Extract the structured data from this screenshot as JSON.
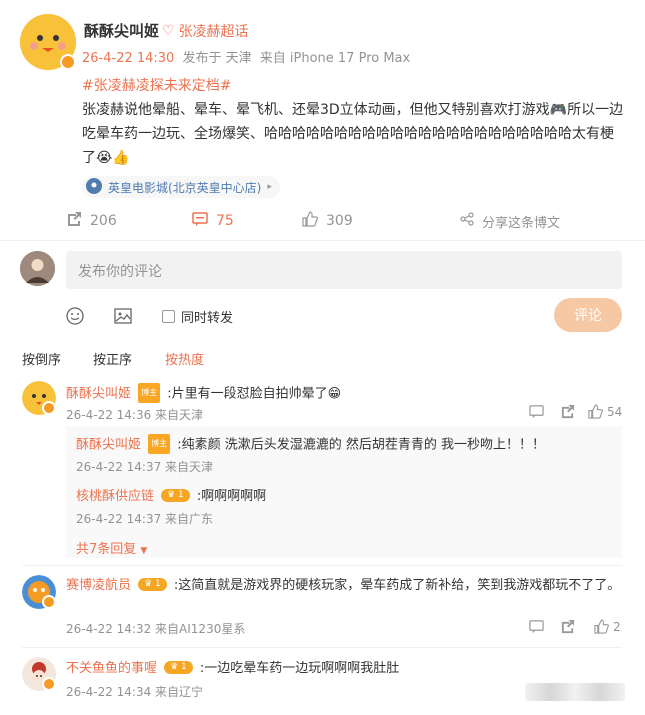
{
  "post": {
    "author": "酥酥尖叫姬",
    "topic_badge": "张凌赫超话",
    "time": "26-4-22 14:30",
    "from_location": "发布于 天津",
    "device": "来自 iPhone 17 Pro Max",
    "hashtag": "#张凌赫凌探未来定档#",
    "text": "张凌赫说他晕船、晕车、晕飞机、还晕3D立体动画，但他又特别喜欢打游戏🎮所以一边吃晕车药一边玩、全场爆笑、哈哈哈哈哈哈哈哈哈哈哈哈哈哈哈哈哈哈哈哈哈哈太有梗了😭👍",
    "location": "英皇电影城(北京英皇中心店)",
    "repost_count": "206",
    "comment_count": "75",
    "like_count": "309",
    "share_label": "分享这条博文"
  },
  "composer": {
    "placeholder": "发布你的评论",
    "repost_label": "同时转发",
    "submit_label": "评论"
  },
  "sort": {
    "oldest": "按倒序",
    "newest": "按正序",
    "hot": "按热度"
  },
  "comments": [
    {
      "name": "酥酥尖叫姬",
      "tag": "博主",
      "text": ":片里有一段怼脸自拍帅晕了😁",
      "meta": "26-4-22 14:36 来自天津",
      "likes": "54",
      "replies": [
        {
          "name": "酥酥尖叫姬",
          "tag": "博主",
          "text": ":纯素颜 洗漱后头发湿漉漉的 然后胡茬青青的 我一秒吻上！！！",
          "meta": "26-4-22 14:37 来自天津"
        },
        {
          "name": "核桃酥供应链",
          "level": "1",
          "text": ":啊啊啊啊啊",
          "meta": "26-4-22 14:37 来自广东"
        }
      ],
      "expand_label": "共7条回复"
    },
    {
      "name": "赛博凌航员",
      "level": "1",
      "text": ":这简直就是游戏界的硬核玩家，晕车药成了新补给，笑到我游戏都玩不了了。",
      "meta": "26-4-22 14:32 来自AI1230星系",
      "likes": "2"
    },
    {
      "name": "不关鱼鱼的事喔",
      "level": "1",
      "text": ":一边吃晕车药一边玩啊啊啊我肚肚",
      "meta": "26-4-22 14:34 来自辽宁"
    }
  ],
  "colors": {
    "accent": "#eb7350",
    "link": "#507daf",
    "button_disabled": "#f7c8a4"
  }
}
